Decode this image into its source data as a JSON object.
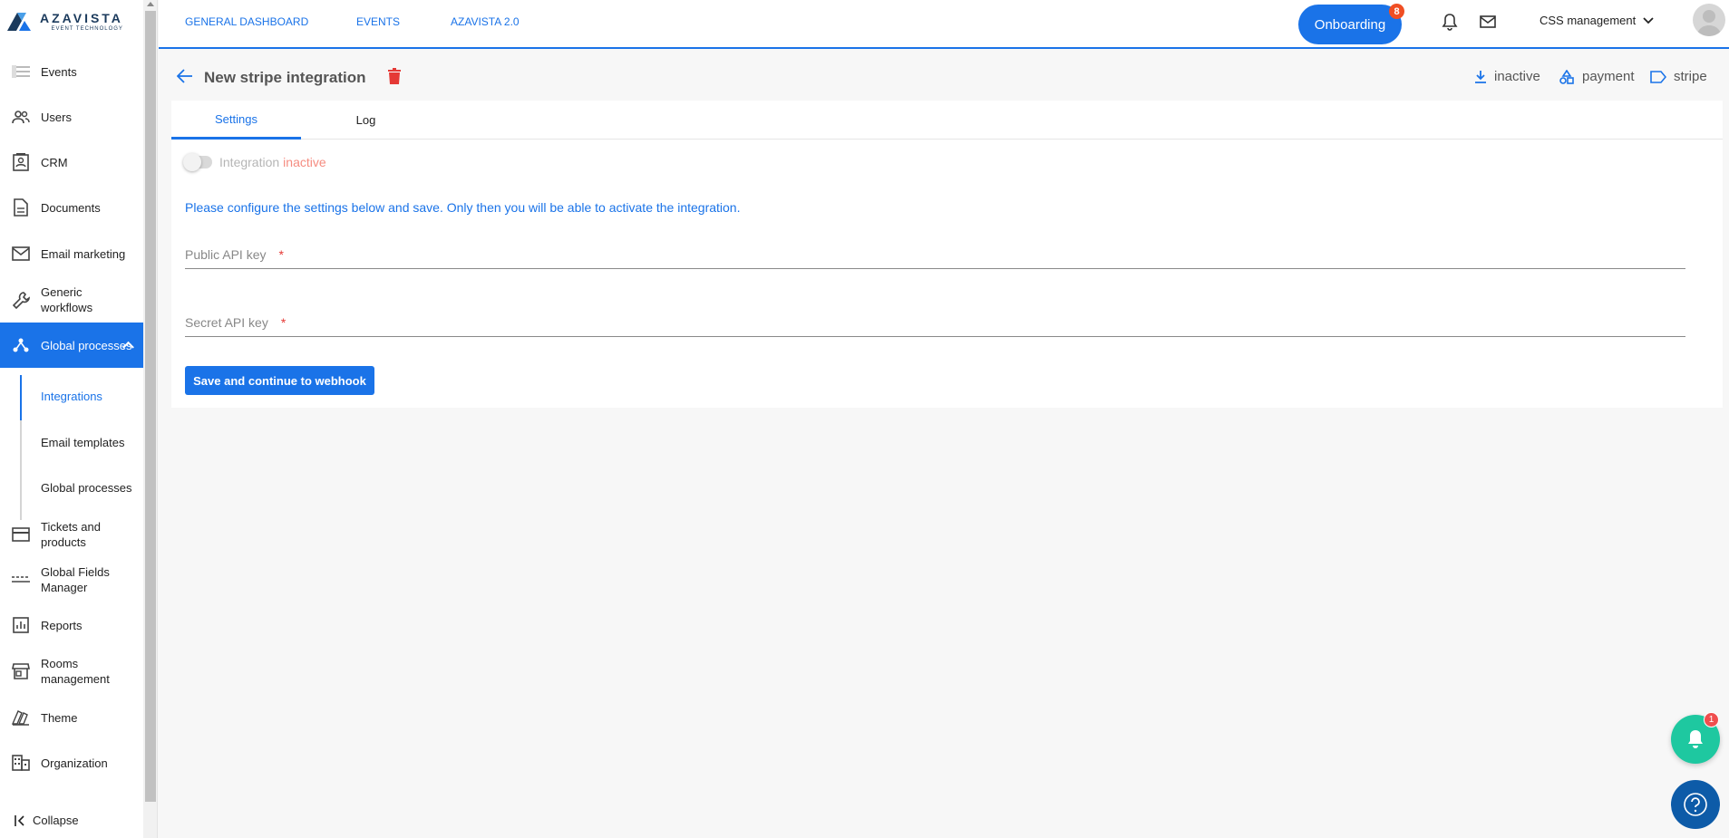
{
  "brand": {
    "name": "AZAVISTA",
    "sub": "EVENT TECHNOLOGY"
  },
  "sidebar": {
    "items": [
      {
        "label": "Events",
        "icon": "events-icon"
      },
      {
        "label": "Users",
        "icon": "users-icon"
      },
      {
        "label": "CRM",
        "icon": "crm-icon"
      },
      {
        "label": "Documents",
        "icon": "document-icon"
      },
      {
        "label": "Email marketing",
        "icon": "mail-icon"
      },
      {
        "label": "Generic workflows",
        "icon": "wrench-icon"
      },
      {
        "label": "Global processes",
        "icon": "process-icon",
        "active": true
      },
      {
        "label": "Tickets and products",
        "icon": "card-icon"
      },
      {
        "label": "Global Fields Manager",
        "icon": "fields-icon"
      },
      {
        "label": "Reports",
        "icon": "chart-icon"
      },
      {
        "label": "Rooms management",
        "icon": "store-icon"
      },
      {
        "label": "Theme",
        "icon": "theme-icon"
      },
      {
        "label": "Organization",
        "icon": "building-icon"
      }
    ],
    "subitems": [
      "Integrations",
      "Email templates",
      "Global processes"
    ],
    "collapse": "Collapse"
  },
  "topbar": {
    "links": [
      "GENERAL DASHBOARD",
      "EVENTS",
      "AZAVISTA 2.0"
    ],
    "onboarding": "Onboarding",
    "onboarding_count": "8",
    "user": "CSS management"
  },
  "page": {
    "title": "New stripe integration",
    "tags": [
      "inactive",
      "payment",
      "stripe"
    ]
  },
  "tabs": [
    "Settings",
    "Log"
  ],
  "form": {
    "toggle_label": "Integration",
    "toggle_state": "inactive",
    "info": "Please configure the settings below and save. Only then you will be able to activate the integration.",
    "public_key_label": "Public API key",
    "secret_key_label": "Secret API key",
    "required_mark": "*",
    "save_button": "Save and continue to webhook"
  },
  "notifications": {
    "count": "1"
  },
  "colors": {
    "accent": "#1a73e8",
    "danger": "#e53935",
    "fab": "#1ec8a0",
    "help": "#0d5ba8"
  }
}
